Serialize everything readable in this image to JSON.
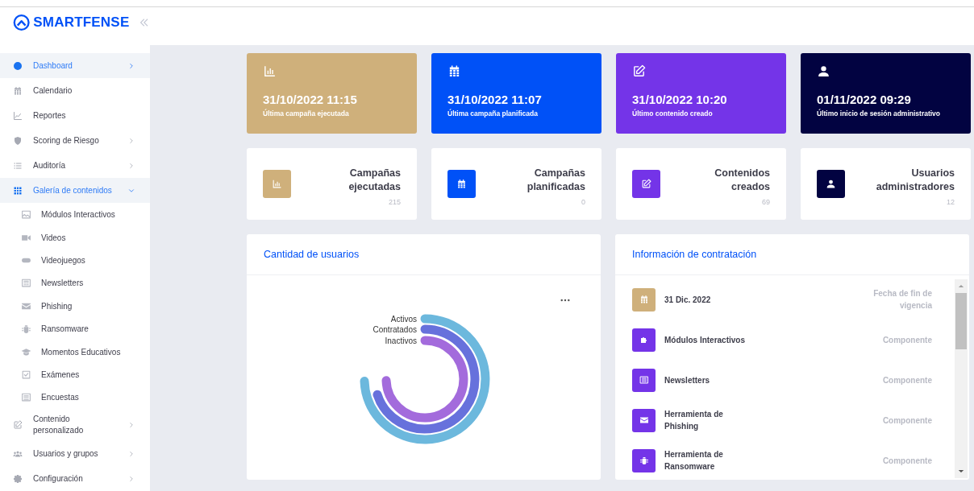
{
  "brand": {
    "name": "SMARTFENSE"
  },
  "sidebar": {
    "items": [
      {
        "label": "Dashboard",
        "selected": true,
        "expanded": false
      },
      {
        "label": "Calendario",
        "selected": false
      },
      {
        "label": "Reportes",
        "selected": false
      },
      {
        "label": "Scoring de Riesgo",
        "selected": false,
        "expanded": false
      },
      {
        "label": "Auditoría",
        "selected": false,
        "expanded": false
      },
      {
        "label": "Galería de contenidos",
        "selected": true,
        "expanded": true,
        "children": [
          {
            "label": "Módulos Interactivos",
            "selected": false
          },
          {
            "label": "Videos",
            "selected": false
          },
          {
            "label": "Videojuegos",
            "selected": false
          },
          {
            "label": "Newsletters",
            "selected": false
          },
          {
            "label": "Phishing",
            "selected": false
          },
          {
            "label": "Ransomware",
            "selected": false
          },
          {
            "label": "Momentos Educativos",
            "selected": false
          },
          {
            "label": "Exámenes",
            "selected": false
          },
          {
            "label": "Encuestas",
            "selected": false
          }
        ]
      },
      {
        "label": "Contenido personalizado",
        "selected": false,
        "expanded": false
      },
      {
        "label": "Usuarios y grupos",
        "selected": false,
        "expanded": false
      },
      {
        "label": "Configuración",
        "selected": false,
        "expanded": false
      }
    ]
  },
  "summary_cards": [
    {
      "value": "31/10/2022 11:15",
      "label": "Última campaña ejecutada",
      "color": "#cfb07b"
    },
    {
      "value": "31/10/2022 11:07",
      "label": "Última campaña planificada",
      "color": "#0051f7"
    },
    {
      "value": "31/10/2022 10:20",
      "label": "Último contenido creado",
      "color": "#7434e8"
    },
    {
      "value": "01/11/2022 09:29",
      "label": "Último inicio de sesión administrativo",
      "color": "#020341"
    }
  ],
  "stat_cards": [
    {
      "title": "Campañas ejecutadas",
      "count": "215",
      "color": "#cfb07b"
    },
    {
      "title": "Campañas planificadas",
      "count": "0",
      "color": "#0051f7"
    },
    {
      "title": "Contenidos creados",
      "count": "69",
      "color": "#7434e8"
    },
    {
      "title": "Usuarios administradores",
      "count": "12",
      "color": "#020341"
    }
  ],
  "users_panel": {
    "title": "Cantidad de usuarios",
    "series": [
      {
        "name": "Activos",
        "color": "#6cb8dd"
      },
      {
        "name": "Contratados",
        "color": "#6771dc"
      },
      {
        "name": "Inactivos",
        "color": "#a36bdc"
      }
    ]
  },
  "contract_panel": {
    "title": "Información de contratación",
    "items": [
      {
        "name": "31 Dic. 2022",
        "detail": "Fecha de fin de vigencia",
        "color": "#cfb07b"
      },
      {
        "name": "Módulos Interactivos",
        "detail": "Componente",
        "color": "#7434e8"
      },
      {
        "name": "Newsletters",
        "detail": "Componente",
        "color": "#7434e8"
      },
      {
        "name": "Herramienta de Phishing",
        "detail": "Componente",
        "color": "#7434e8"
      },
      {
        "name": "Herramienta de Ransomware",
        "detail": "Componente",
        "color": "#7434e8"
      }
    ]
  }
}
